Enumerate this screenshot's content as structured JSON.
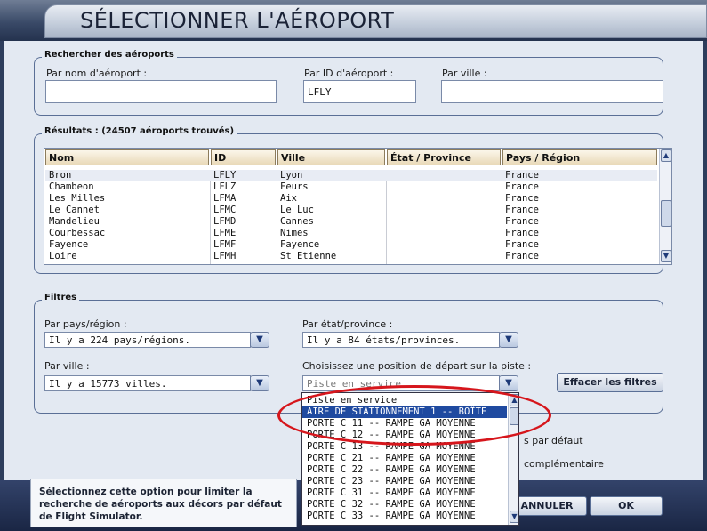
{
  "window": {
    "title": "SÉLECTIONNER L'AÉROPORT"
  },
  "search": {
    "legend": "Rechercher des aéroports",
    "by_name_label": "Par nom d'aéroport :",
    "by_name_value": "",
    "by_id_label": "Par ID d'aéroport :",
    "by_id_value": "LFLY",
    "by_city_label": "Par ville :",
    "by_city_value": ""
  },
  "results": {
    "legend": "Résultats : (24507 aéroports trouvés)",
    "columns": [
      "Nom",
      "ID",
      "Ville",
      "État / Province",
      "Pays / Région"
    ],
    "rows": [
      {
        "nom": "Bron",
        "id": "LFLY",
        "ville": "Lyon",
        "etat": "",
        "pays": "France"
      },
      {
        "nom": "Chambeon",
        "id": "LFLZ",
        "ville": "Feurs",
        "etat": "",
        "pays": "France"
      },
      {
        "nom": "Les Milles",
        "id": "LFMA",
        "ville": "Aix",
        "etat": "",
        "pays": "France"
      },
      {
        "nom": "Le Cannet",
        "id": "LFMC",
        "ville": "Le Luc",
        "etat": "",
        "pays": "France"
      },
      {
        "nom": "Mandelieu",
        "id": "LFMD",
        "ville": "Cannes",
        "etat": "",
        "pays": "France"
      },
      {
        "nom": "Courbessac",
        "id": "LFME",
        "ville": "Nimes",
        "etat": "",
        "pays": "France"
      },
      {
        "nom": "Fayence",
        "id": "LFMF",
        "ville": "Fayence",
        "etat": "",
        "pays": "France"
      },
      {
        "nom": "Loire",
        "id": "LFMH",
        "ville": "St Etienne",
        "etat": "",
        "pays": "France"
      }
    ]
  },
  "filters": {
    "legend": "Filtres",
    "country_label": "Par pays/région :",
    "country_value": "Il y a 224 pays/régions.",
    "state_label": "Par état/province :",
    "state_value": "Il y a 84 états/provinces.",
    "city_label": "Par ville :",
    "city_value": "Il y a 15773 villes.",
    "runway_label": "Choisissez une position de départ sur la piste :",
    "runway_value": "Piste en service",
    "clear_button": "Effacer les filtres"
  },
  "runway_dropdown": {
    "items": [
      "Piste en service",
      "AIRE DE STATIONNEMENT 1 -- BOÎTE",
      "PORTE C 11 -- RAMPE GA MOYENNE",
      "PORTE C 12 -- RAMPE GA MOYENNE",
      "PORTE C 13 -- RAMPE GA MOYENNE",
      "PORTE C 21 -- RAMPE GA MOYENNE",
      "PORTE C 22 -- RAMPE GA MOYENNE",
      "PORTE C 23 -- RAMPE GA MOYENNE",
      "PORTE C 31 -- RAMPE GA MOYENNE",
      "PORTE C 32 -- RAMPE GA MOYENNE",
      "PORTE C 33 -- RAMPE GA MOYENNE"
    ],
    "highlighted_index": 1
  },
  "options": {
    "default_scenery_partial": "s par défaut",
    "addon_scenery_partial": "complémentaire"
  },
  "footer": {
    "help_text": "Sélectionnez cette option pour limiter la recherche de aéroports aux décors par défaut de Flight Simulator.",
    "cancel_label": "ANNULER",
    "ok_label": "OK"
  },
  "colors": {
    "annotation_circle": "#d6161c",
    "highlight": "#1f4aa0"
  }
}
